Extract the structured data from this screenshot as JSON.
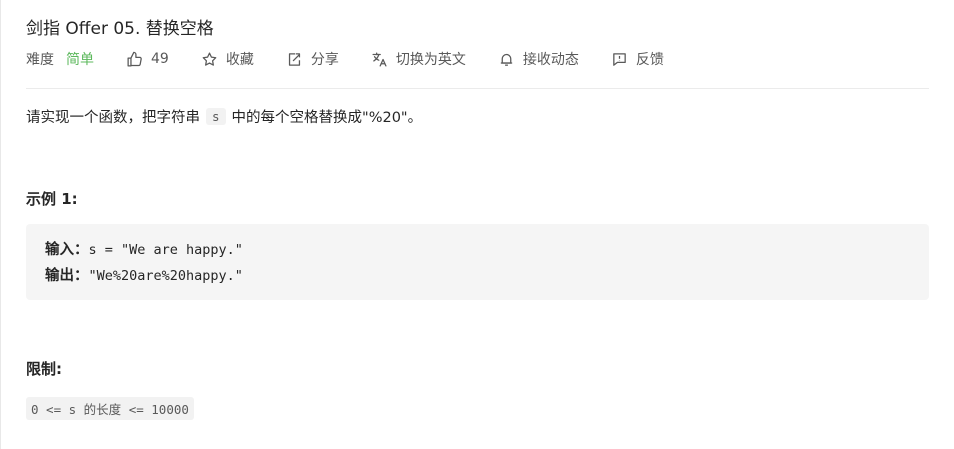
{
  "problem": {
    "title": "剑指 Offer 05. 替换空格"
  },
  "meta": {
    "difficulty_label": "难度",
    "difficulty_value": "简单",
    "difficulty_color": "#5cb85c",
    "likes_count": "49",
    "favorite_label": "收藏",
    "share_label": "分享",
    "switch_lang_label": "切换为英文",
    "notify_label": "接收动态",
    "feedback_label": "反馈",
    "icons": [
      "thumbs-up-icon",
      "star-icon",
      "share-icon",
      "translate-icon",
      "bell-icon",
      "feedback-icon"
    ]
  },
  "description": {
    "before": "请实现一个函数，把字符串",
    "code": "s",
    "after": "中的每个空格替换成\"%20\"。"
  },
  "example": {
    "heading": "示例 1:",
    "input_label": "输入：",
    "input_value": "s = \"We are happy.\"",
    "output_label": "输出：",
    "output_value": "\"We%20are%20happy.\""
  },
  "constraints": {
    "heading": "限制:",
    "item": "0 <= s 的长度 <= 10000"
  }
}
